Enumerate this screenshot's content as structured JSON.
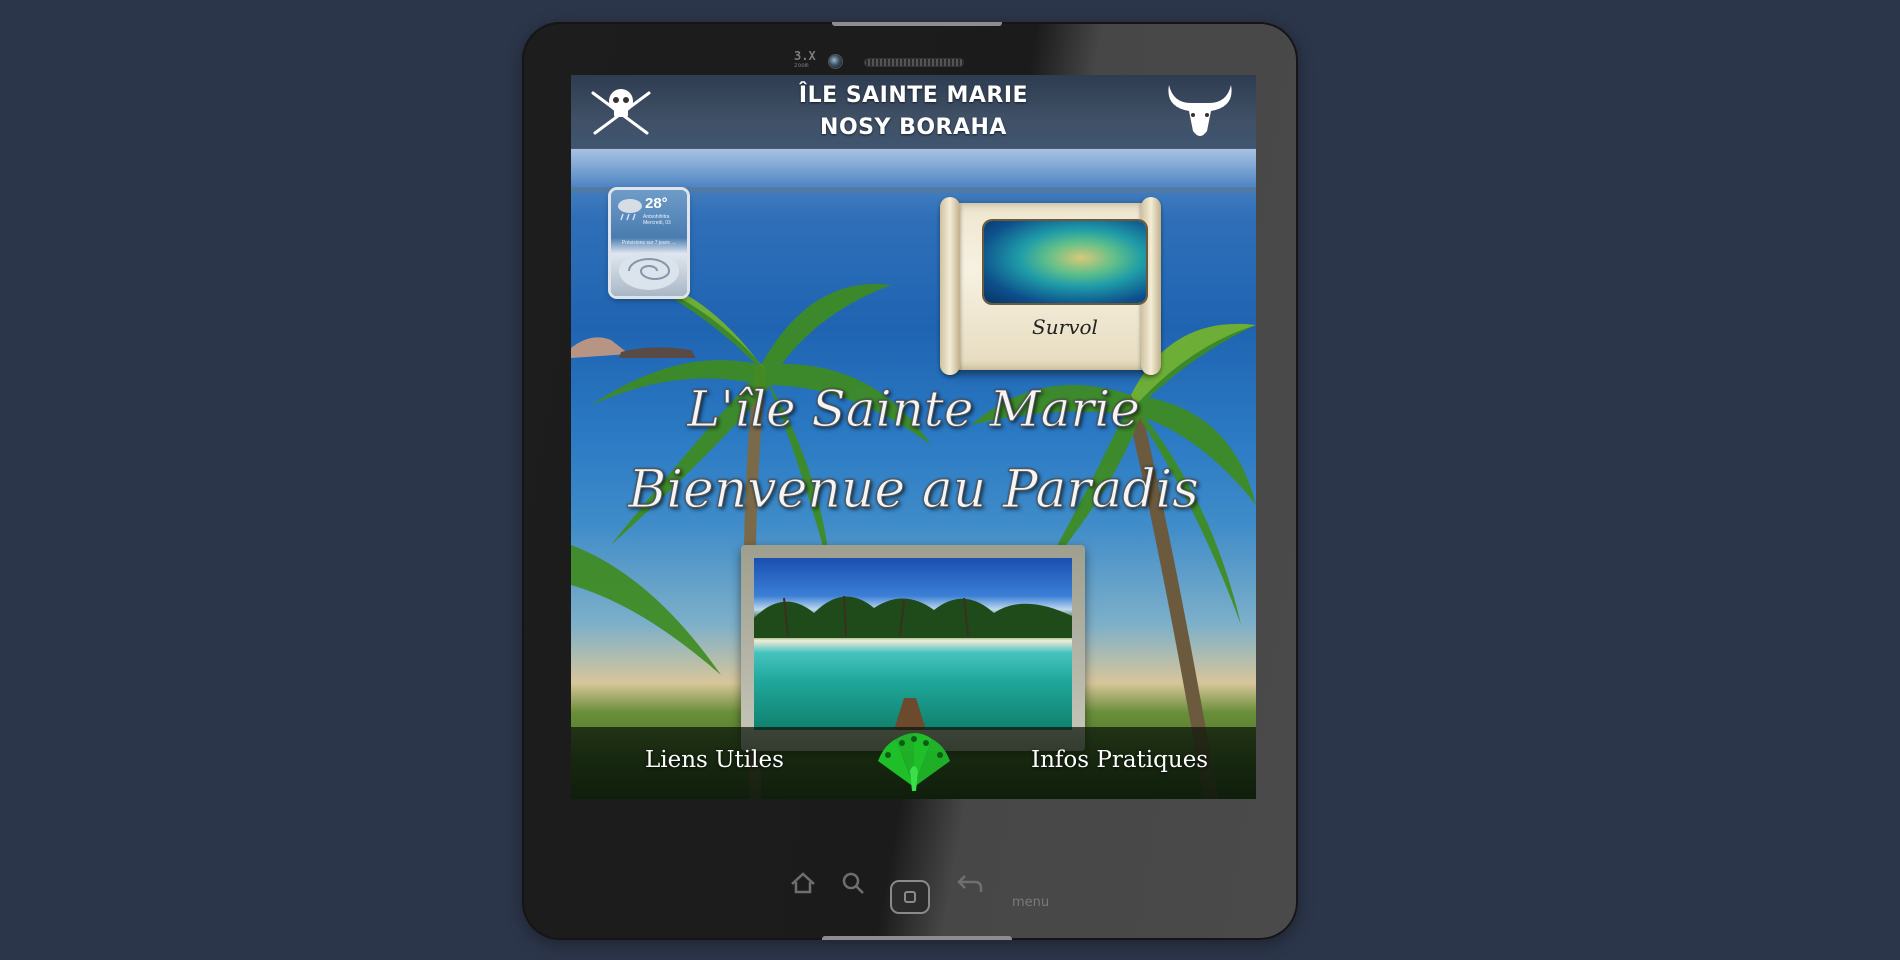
{
  "header": {
    "title_line1": "ÎLE SAINTE MARIE",
    "title_line2": "NOSY BORAHA"
  },
  "device": {
    "zoom_label": "3.X",
    "zoom_sub": "zoom",
    "menu_label": "menu"
  },
  "weather": {
    "temperature": "28°",
    "city": "Antsohihitra Mercredi, 03",
    "forecast": "Prévisions sur 7 jours →"
  },
  "scroll_card": {
    "label": "Survol"
  },
  "main": {
    "title_line1": "L'île Sainte Marie",
    "title_line2": "Bienvenue au Paradis"
  },
  "footer": {
    "left_link": "Liens Utiles",
    "right_link": "Infos Pratiques"
  },
  "colors": {
    "page_background": "#2c364a",
    "peacock_green": "#1fbf2a"
  }
}
